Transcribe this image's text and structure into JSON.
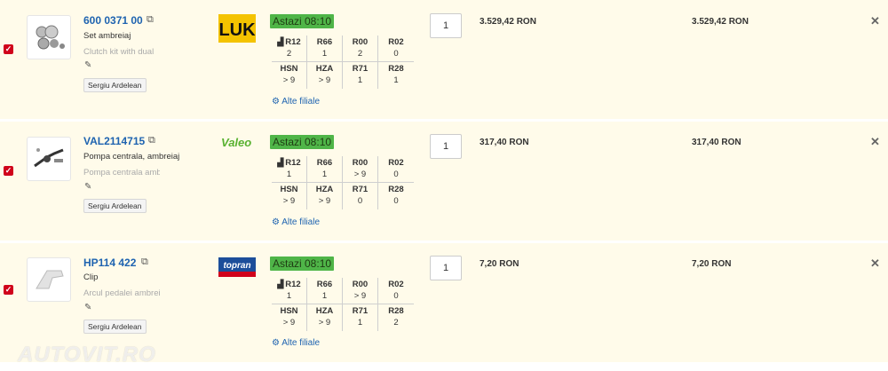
{
  "rows": [
    {
      "code": "600 0371 00",
      "name": "Set ambreiaj",
      "desc": "Clutch kit with dual",
      "user": "Sergiu Ardelean",
      "brand": "LUK",
      "availability": "Astazi 08:10",
      "stock_top": [
        {
          "label": "R12",
          "value": "2"
        },
        {
          "label": "R66",
          "value": "1"
        },
        {
          "label": "R00",
          "value": "2"
        },
        {
          "label": "R02",
          "value": "0"
        }
      ],
      "stock_bottom": [
        {
          "label": "HSN",
          "value": "> 9"
        },
        {
          "label": "HZA",
          "value": "> 9"
        },
        {
          "label": "R71",
          "value": "1"
        },
        {
          "label": "R28",
          "value": "1"
        }
      ],
      "other_branches": "Alte filiale",
      "qty": "1",
      "price": "3.529,42 RON",
      "total": "3.529,42 RON"
    },
    {
      "code": "VAL2114715",
      "name": "Pompa centrala, ambreiaj",
      "desc": "Pompa centrala ambreiaj",
      "user": "Sergiu Ardelean",
      "brand": "Valeo",
      "availability": "Astazi 08:10",
      "stock_top": [
        {
          "label": "R12",
          "value": "1"
        },
        {
          "label": "R66",
          "value": "1"
        },
        {
          "label": "R00",
          "value": "> 9"
        },
        {
          "label": "R02",
          "value": "0"
        }
      ],
      "stock_bottom": [
        {
          "label": "HSN",
          "value": "> 9"
        },
        {
          "label": "HZA",
          "value": "> 9"
        },
        {
          "label": "R71",
          "value": "0"
        },
        {
          "label": "R28",
          "value": "0"
        }
      ],
      "other_branches": "Alte filiale",
      "qty": "1",
      "price": "317,40 RON",
      "total": "317,40 RON"
    },
    {
      "code": "HP114 422",
      "name": "Clip",
      "desc": "Arcul pedalei ambreiaj",
      "user": "Sergiu Ardelean",
      "brand": "topran",
      "availability": "Astazi 08:10",
      "stock_top": [
        {
          "label": "R12",
          "value": "1"
        },
        {
          "label": "R66",
          "value": "1"
        },
        {
          "label": "R00",
          "value": "> 9"
        },
        {
          "label": "R02",
          "value": "0"
        }
      ],
      "stock_bottom": [
        {
          "label": "HSN",
          "value": "> 9"
        },
        {
          "label": "HZA",
          "value": "> 9"
        },
        {
          "label": "R71",
          "value": "1"
        },
        {
          "label": "R28",
          "value": "2"
        }
      ],
      "other_branches": "Alte filiale",
      "qty": "1",
      "price": "7,20 RON",
      "total": "7,20 RON"
    }
  ],
  "colors": {
    "row_bg": "#fffbea",
    "link": "#1e63b0",
    "availability": "#4fb548",
    "checkbox": "#d0021b"
  },
  "icons": {
    "copy": "copy-icon",
    "edit": "edit-icon",
    "warehouse": "warehouse-icon",
    "branches": "branches-icon",
    "delete": "close-icon"
  },
  "watermark": "AUTOVIT.RO"
}
